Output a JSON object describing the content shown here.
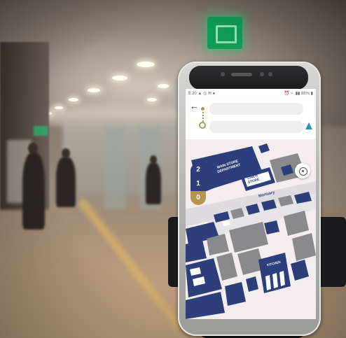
{
  "scene": {
    "description_hidden": "",
    "exit_sign_color": "#0f9a55"
  },
  "phone": {
    "status_bar": {
      "time": "6:30",
      "left_icons": "▲ ◎ ✉ ●",
      "right_icons": "⏰ ⌁ .▮▮ 86% ▮"
    },
    "header": {
      "back_icon": "arrow-left-icon",
      "origin_placeholder": "",
      "destination_placeholder": "",
      "route_color": "#b7954f",
      "nav_icon": "navigation-arrow-icon"
    },
    "map": {
      "floors": [
        "2",
        "1",
        "0"
      ],
      "selected_floor": "0",
      "floor_color": "#2d3f7a",
      "selected_floor_color": "#b7954f",
      "labels": {
        "main_store": "MAIN STORE\nDEPARTMENT",
        "linen_store": "LINEN\nSTORE",
        "street": "Mortuary",
        "kitchen": "KITCHEN"
      },
      "locate_icon": "crosshair-icon",
      "colors": {
        "room_blue": "#2d3f7a",
        "room_gray": "#8a8a8c",
        "corridor": "#dedcde",
        "background": "#f3edf0"
      }
    }
  }
}
